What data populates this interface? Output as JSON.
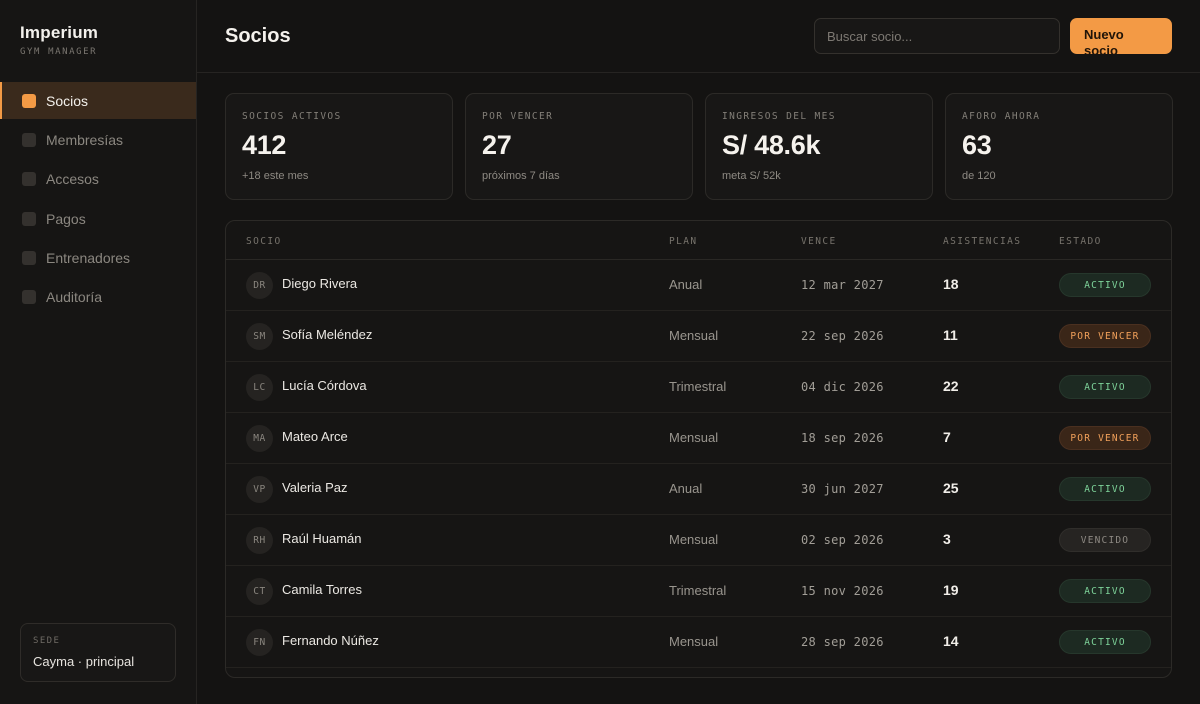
{
  "brand": {
    "name": "Imperium",
    "subtitle": "GYM MANAGER"
  },
  "sidebar": {
    "items": [
      {
        "label": "Socios",
        "active": true
      },
      {
        "label": "Membresías",
        "active": false
      },
      {
        "label": "Accesos",
        "active": false
      },
      {
        "label": "Pagos",
        "active": false
      },
      {
        "label": "Entrenadores",
        "active": false
      },
      {
        "label": "Auditoría",
        "active": false
      }
    ],
    "sede": {
      "label": "SEDE",
      "value": "Cayma · principal"
    }
  },
  "header": {
    "title": "Socios",
    "search_placeholder": "Buscar socio...",
    "new_button": "Nuevo socio"
  },
  "stats": [
    {
      "label": "SOCIOS ACTIVOS",
      "value": "412",
      "sub": "+18 este mes"
    },
    {
      "label": "POR VENCER",
      "value": "27",
      "sub": "próximos 7 días"
    },
    {
      "label": "INGRESOS DEL MES",
      "value": "S/ 48.6k",
      "sub": "meta S/ 52k"
    },
    {
      "label": "AFORO AHORA",
      "value": "63",
      "sub": "de 120"
    }
  ],
  "table": {
    "columns": {
      "socio": "SOCIO",
      "plan": "PLAN",
      "vence": "VENCE",
      "asistencias": "ASISTENCIAS",
      "estado": "ESTADO"
    },
    "rows": [
      {
        "initials": "DR",
        "name": "Diego Rivera",
        "plan": "Anual",
        "vence": "12 mar 2027",
        "asistencias": "18",
        "estado": "ACTIVO",
        "status": "activo"
      },
      {
        "initials": "SM",
        "name": "Sofía Meléndez",
        "plan": "Mensual",
        "vence": "22 sep 2026",
        "asistencias": "11",
        "estado": "POR VENCER",
        "status": "porvencer"
      },
      {
        "initials": "LC",
        "name": "Lucía Córdova",
        "plan": "Trimestral",
        "vence": "04 dic 2026",
        "asistencias": "22",
        "estado": "ACTIVO",
        "status": "activo"
      },
      {
        "initials": "MA",
        "name": "Mateo Arce",
        "plan": "Mensual",
        "vence": "18 sep 2026",
        "asistencias": "7",
        "estado": "POR VENCER",
        "status": "porvencer"
      },
      {
        "initials": "VP",
        "name": "Valeria Paz",
        "plan": "Anual",
        "vence": "30 jun 2027",
        "asistencias": "25",
        "estado": "ACTIVO",
        "status": "activo"
      },
      {
        "initials": "RH",
        "name": "Raúl Huamán",
        "plan": "Mensual",
        "vence": "02 sep 2026",
        "asistencias": "3",
        "estado": "VENCIDO",
        "status": "vencido"
      },
      {
        "initials": "CT",
        "name": "Camila Torres",
        "plan": "Trimestral",
        "vence": "15 nov 2026",
        "asistencias": "19",
        "estado": "ACTIVO",
        "status": "activo"
      },
      {
        "initials": "FN",
        "name": "Fernando Núñez",
        "plan": "Mensual",
        "vence": "28 sep 2026",
        "asistencias": "14",
        "estado": "ACTIVO",
        "status": "activo"
      }
    ]
  },
  "colors": {
    "accent": "#f39a45",
    "background": "#141312",
    "active_badge": "#7ed39a",
    "warning_badge": "#f0a05a"
  }
}
